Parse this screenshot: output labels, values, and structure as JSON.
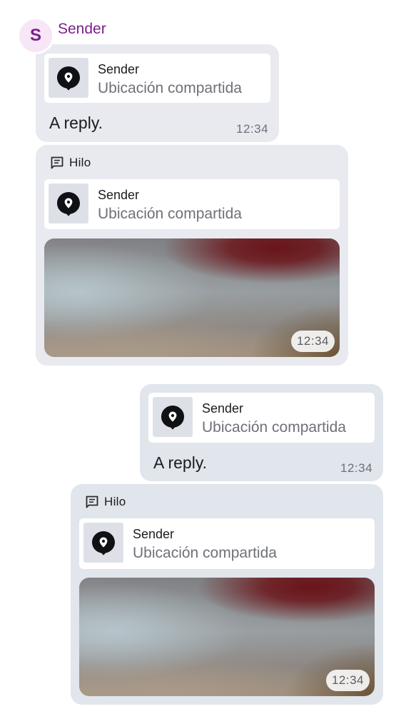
{
  "header": {
    "avatar_initial": "S",
    "sender_name": "Sender"
  },
  "messages": [
    {
      "reply": {
        "sender": "Sender",
        "body": "Ubicación compartida",
        "icon": "map-pin-icon"
      },
      "text": "A reply.",
      "time": "12:34"
    },
    {
      "thread_label": "Hilo",
      "thread_icon": "thread-icon",
      "reply": {
        "sender": "Sender",
        "body": "Ubicación compartida",
        "icon": "map-pin-icon"
      },
      "media_time": "12:34"
    },
    {
      "reply": {
        "sender": "Sender",
        "body": "Ubicación compartida",
        "icon": "map-pin-icon"
      },
      "text": "A reply.",
      "time": "12:34"
    },
    {
      "thread_label": "Hilo",
      "thread_icon": "thread-icon",
      "reply": {
        "sender": "Sender",
        "body": "Ubicación compartida",
        "icon": "map-pin-icon"
      },
      "media_time": "12:34"
    }
  ],
  "colors": {
    "sender_accent": "#7b1f8e",
    "bubble_incoming": "#e8eaf0",
    "bubble_outgoing": "#e1e5ec"
  }
}
